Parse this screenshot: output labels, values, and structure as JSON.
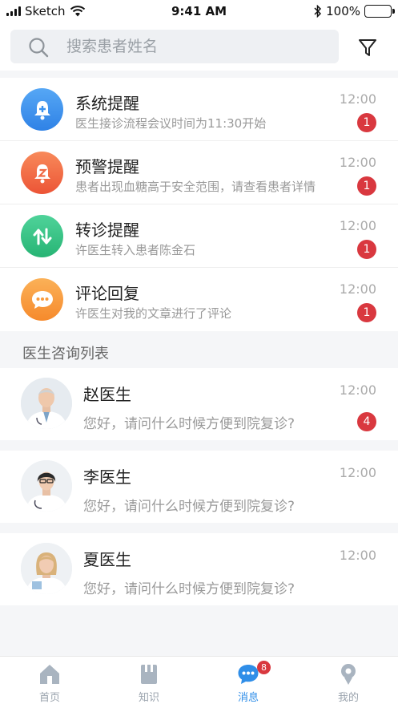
{
  "status_bar": {
    "carrier": "Sketch",
    "time": "9:41 AM",
    "battery": "100%"
  },
  "search": {
    "placeholder": "搜索患者姓名"
  },
  "notices": [
    {
      "title": "系统提醒",
      "desc": "医生接诊流程会议时间为11:30开始",
      "time": "12:00",
      "badge": "1",
      "icon": "bell-plus-icon",
      "color": "#3a92ee"
    },
    {
      "title": "预警提醒",
      "desc": "患者出现血糖高于安全范围，请查看患者详情",
      "time": "12:00",
      "badge": "1",
      "icon": "alarm-bell-icon",
      "color": "#f06a45"
    },
    {
      "title": "转诊提醒",
      "desc": "许医生转入患者陈金石",
      "time": "12:00",
      "badge": "1",
      "icon": "transfer-arrows-icon",
      "color": "#36c386"
    },
    {
      "title": "评论回复",
      "desc": "许医生对我的文章进行了评论",
      "time": "12:00",
      "badge": "1",
      "icon": "comment-icon",
      "color": "#f99a3c"
    }
  ],
  "consult_section": {
    "title": "医生咨询列表"
  },
  "doctors": [
    {
      "name": "赵医生",
      "message": "您好，请问什么时候方便到院复诊?",
      "time": "12:00",
      "badge": "4"
    },
    {
      "name": "李医生",
      "message": "您好，请问什么时候方便到院复诊?",
      "time": "12:00",
      "badge": ""
    },
    {
      "name": "夏医生",
      "message": "您好，请问什么时候方便到院复诊?",
      "time": "12:00",
      "badge": ""
    }
  ],
  "tabbar": {
    "tabs": [
      {
        "label": "首页",
        "icon": "home-icon"
      },
      {
        "label": "知识",
        "icon": "book-icon"
      },
      {
        "label": "消息",
        "icon": "message-icon",
        "badge": "8",
        "active": true
      },
      {
        "label": "我的",
        "icon": "profile-icon"
      }
    ]
  },
  "colors": {
    "accent": "#2f8ee8",
    "badge": "#d9383f"
  }
}
